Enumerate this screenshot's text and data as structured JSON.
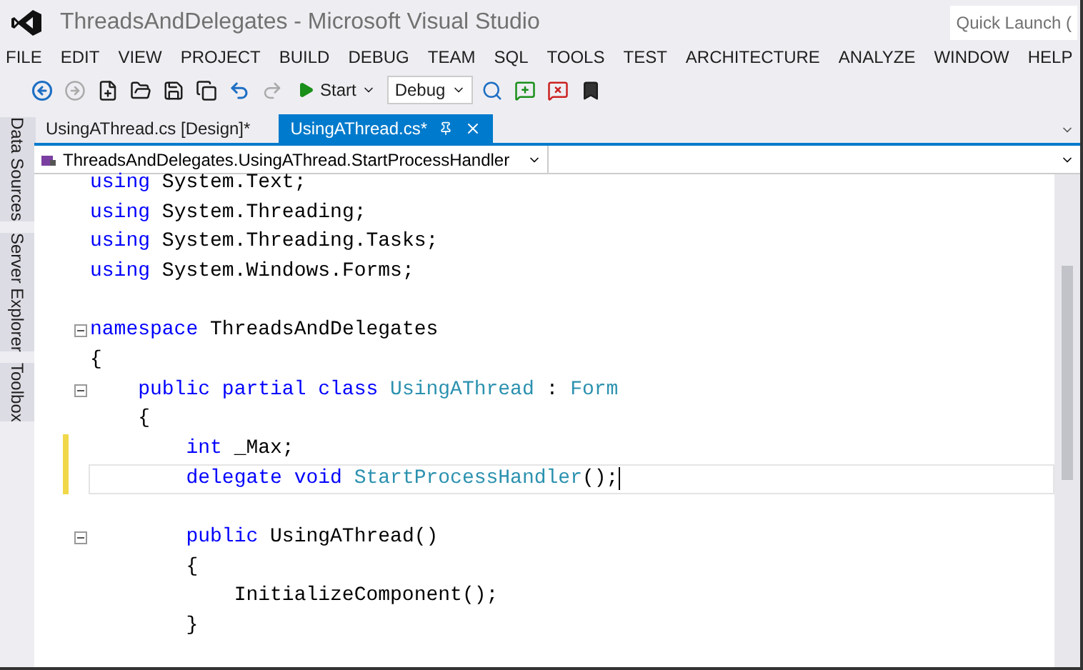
{
  "window": {
    "title": "ThreadsAndDelegates - Microsoft Visual Studio",
    "quick_launch": "Quick Launch ("
  },
  "menu": [
    "FILE",
    "EDIT",
    "VIEW",
    "PROJECT",
    "BUILD",
    "DEBUG",
    "TEAM",
    "SQL",
    "TOOLS",
    "TEST",
    "ARCHITECTURE",
    "ANALYZE",
    "WINDOW",
    "HELP"
  ],
  "toolbar": {
    "start": "Start",
    "configuration": "Debug"
  },
  "side_tabs": [
    "Data Sources",
    "Server Explorer",
    "Toolbox"
  ],
  "tabs": [
    {
      "label": "UsingAThread.cs [Design]*",
      "selected": false
    },
    {
      "label": "UsingAThread.cs*",
      "selected": true
    }
  ],
  "navigation": {
    "member": "ThreadsAndDelegates.UsingAThread.StartProcessHandler"
  },
  "code": {
    "lines": [
      {
        "fold": false,
        "changed": false,
        "current": false,
        "tokens": [
          {
            "kind": "keyword",
            "text": "using"
          },
          {
            "kind": "plain",
            "text": " System.Text;"
          }
        ]
      },
      {
        "fold": false,
        "changed": false,
        "current": false,
        "tokens": [
          {
            "kind": "keyword",
            "text": "using"
          },
          {
            "kind": "plain",
            "text": " System.Threading;"
          }
        ]
      },
      {
        "fold": false,
        "changed": false,
        "current": false,
        "tokens": [
          {
            "kind": "keyword",
            "text": "using"
          },
          {
            "kind": "plain",
            "text": " System.Threading.Tasks;"
          }
        ]
      },
      {
        "fold": false,
        "changed": false,
        "current": false,
        "tokens": [
          {
            "kind": "keyword",
            "text": "using"
          },
          {
            "kind": "plain",
            "text": " System.Windows.Forms;"
          }
        ]
      },
      {
        "fold": false,
        "changed": false,
        "current": false
      },
      {
        "fold": true,
        "changed": false,
        "current": false,
        "tokens": [
          {
            "kind": "keyword",
            "text": "namespace"
          },
          {
            "kind": "plain",
            "text": " ThreadsAndDelegates"
          }
        ]
      },
      {
        "fold": false,
        "changed": false,
        "current": false,
        "tokens": [
          {
            "kind": "plain",
            "text": "{"
          }
        ]
      },
      {
        "fold": true,
        "changed": false,
        "current": false,
        "tokens": [
          {
            "kind": "keyword",
            "text": "    public partial class"
          },
          {
            "kind": "type",
            "text": " UsingAThread"
          },
          {
            "kind": "plain",
            "text": " : "
          },
          {
            "kind": "type",
            "text": "Form"
          }
        ]
      },
      {
        "fold": false,
        "changed": false,
        "current": false,
        "tokens": [
          {
            "kind": "plain",
            "text": "    {"
          }
        ]
      },
      {
        "fold": false,
        "changed": true,
        "current": false,
        "tokens": [
          {
            "kind": "keyword",
            "text": "        int"
          },
          {
            "kind": "plain",
            "text": " _Max;"
          }
        ]
      },
      {
        "fold": false,
        "changed": true,
        "current": true,
        "tokens": [
          {
            "kind": "keyword",
            "text": "        delegate void"
          },
          {
            "kind": "type",
            "text": " StartProcessHandler"
          },
          {
            "kind": "plain",
            "text": "();"
          }
        ]
      },
      {
        "fold": false,
        "changed": false,
        "current": false
      },
      {
        "fold": true,
        "changed": false,
        "current": false,
        "tokens": [
          {
            "kind": "keyword",
            "text": "        public"
          },
          {
            "kind": "plain",
            "text": " UsingAThread()"
          }
        ]
      },
      {
        "fold": false,
        "changed": false,
        "current": false,
        "tokens": [
          {
            "kind": "plain",
            "text": "        {"
          }
        ]
      },
      {
        "fold": false,
        "changed": false,
        "current": false,
        "tokens": [
          {
            "kind": "plain",
            "text": "            InitializeComponent();"
          }
        ]
      },
      {
        "fold": false,
        "changed": false,
        "current": false,
        "tokens": [
          {
            "kind": "plain",
            "text": "        }"
          }
        ]
      }
    ]
  }
}
